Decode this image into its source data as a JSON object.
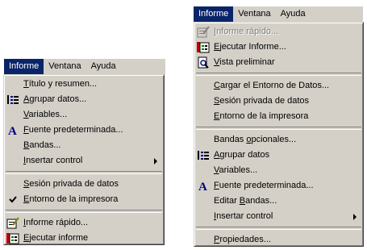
{
  "left": {
    "menubar": [
      "Informe",
      "Ventana",
      "Ayuda"
    ],
    "items": [
      {
        "pre": "",
        "ul": "T",
        "post": "ítulo y resumen..."
      },
      {
        "pre": "",
        "ul": "A",
        "post": "grupar datos..."
      },
      {
        "pre": "",
        "ul": "V",
        "post": "ariables..."
      },
      {
        "pre": "",
        "ul": "F",
        "post": "uente predeterminada..."
      },
      {
        "pre": "",
        "ul": "B",
        "post": "andas..."
      },
      {
        "pre": "",
        "ul": "I",
        "post": "nsertar control"
      },
      {
        "pre": "",
        "ul": "S",
        "post": "esión privada de datos"
      },
      {
        "pre": "",
        "ul": "E",
        "post": "ntorno de la impresora"
      },
      {
        "pre": "",
        "ul": "I",
        "post": "nforme rápido..."
      },
      {
        "pre": "",
        "ul": "E",
        "post": "jecutar informe"
      }
    ]
  },
  "right": {
    "menubar": [
      "Informe",
      "Ventana",
      "Ayuda"
    ],
    "items": [
      {
        "pre": "",
        "ul": "I",
        "post": "nforme rápido..."
      },
      {
        "pre": "",
        "ul": "E",
        "post": "jecutar Informe..."
      },
      {
        "pre": "",
        "ul": "V",
        "post": "ista preliminar"
      },
      {
        "pre": "",
        "ul": "C",
        "post": "argar el Entorno de Datos..."
      },
      {
        "pre": "",
        "ul": "S",
        "post": "esión privada de datos"
      },
      {
        "pre": "",
        "ul": "E",
        "post": "ntorno de la impresora"
      },
      {
        "pre": "Bandas ",
        "ul": "o",
        "post": "pcionales..."
      },
      {
        "pre": "",
        "ul": "A",
        "post": "grupar datos"
      },
      {
        "pre": "",
        "ul": "V",
        "post": "ariables..."
      },
      {
        "pre": "",
        "ul": "F",
        "post": "uente predeterminada..."
      },
      {
        "pre": "Editar ",
        "ul": "B",
        "post": "andas..."
      },
      {
        "pre": "",
        "ul": "I",
        "post": "nsertar control"
      },
      {
        "pre": "",
        "ul": "P",
        "post": "ropiedades..."
      }
    ]
  }
}
